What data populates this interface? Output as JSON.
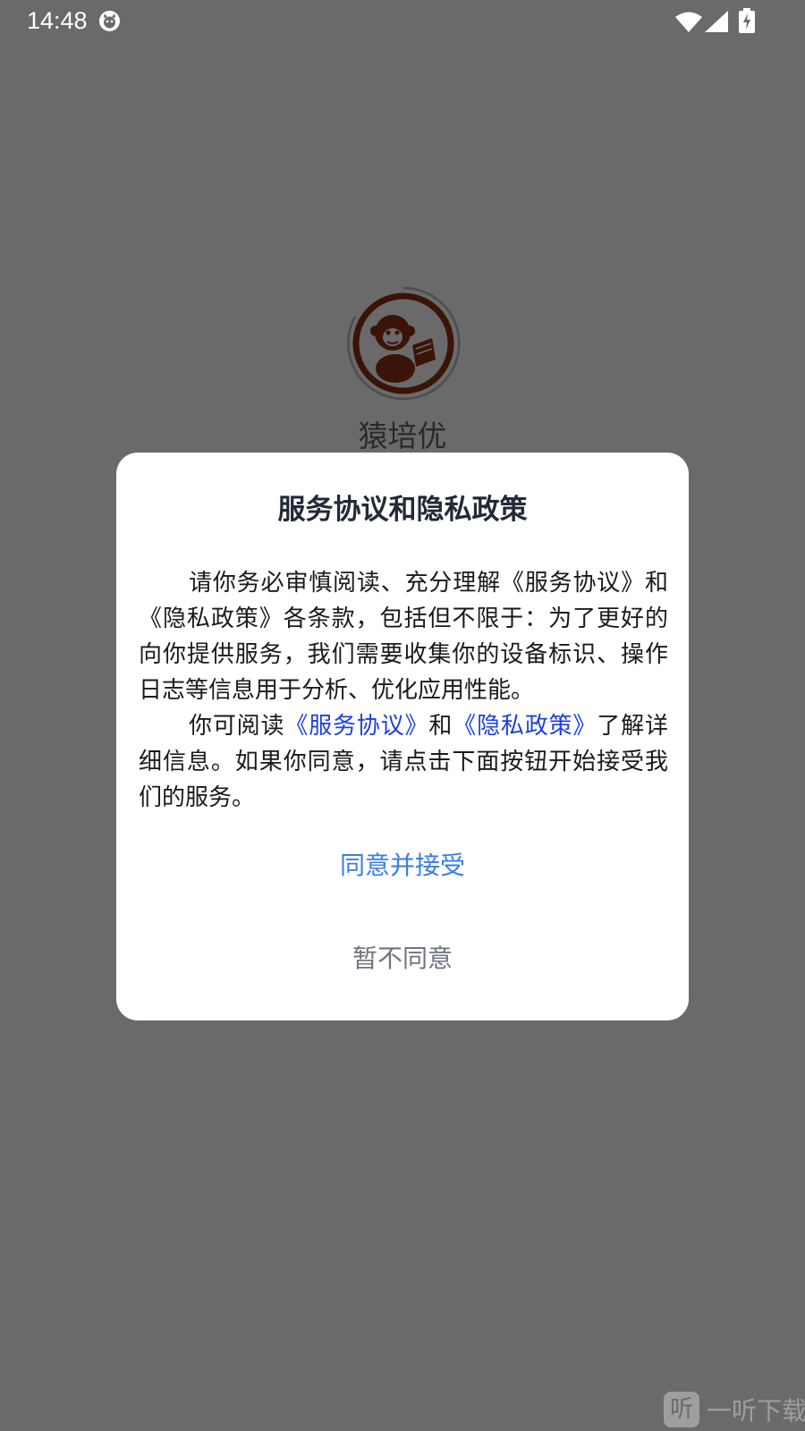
{
  "status_bar": {
    "time": "14:48",
    "icons": [
      "cat-notification-icon",
      "wifi-icon",
      "cellular-signal-icon",
      "battery-charging-icon"
    ]
  },
  "splash": {
    "app_name": "猿培优",
    "logo_icon": "monkey-reading-logo-icon"
  },
  "dialog": {
    "title": "服务协议和隐私政策",
    "paragraph1": "请你务必审慎阅读、充分理解《服务协议》和《隐私政策》各条款，包括但不限于：为了更好的向你提供服务，我们需要收集你的设备标识、操作日志等信息用于分析、优化应用性能。",
    "paragraph2_prefix": "你可阅读",
    "link_service": "《服务协议》",
    "paragraph2_and": "和",
    "link_privacy": "《隐私政策》",
    "paragraph2_suffix": "了解详细信息。如果你同意，请点击下面按钮开始接受我们的服务。",
    "agree_label": "同意并接受",
    "disagree_label": "暂不同意"
  },
  "watermark": {
    "logo_char": "听",
    "text": "一听下载"
  },
  "colors": {
    "overlay": "#6a6a6a",
    "link": "#1f3fe0",
    "agree": "#3b7de6",
    "disagree": "#6f7480"
  }
}
